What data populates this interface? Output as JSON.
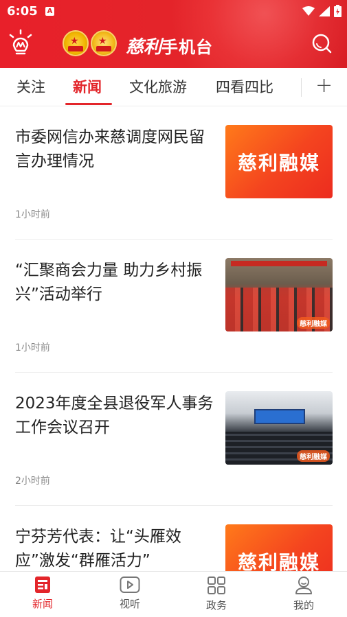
{
  "status_bar": {
    "time": "6:05",
    "notification_icon": "A"
  },
  "header": {
    "brand_script": "慈利",
    "brand_suffix": "手机台"
  },
  "tabs": [
    {
      "label": "关注"
    },
    {
      "label": "新闻"
    },
    {
      "label": "文化旅游"
    },
    {
      "label": "四看四比"
    }
  ],
  "news": [
    {
      "title": "市委网信办来慈调度网民留言办理情况",
      "time": "1小时前",
      "thumb_text": "慈利融媒"
    },
    {
      "title": "“汇聚商会力量 助力乡村振兴”活动举行",
      "time": "1小时前",
      "thumb_tag": "慈利融媒"
    },
    {
      "title": "2023年度全县退役军人事务工作会议召开",
      "time": "2小时前",
      "thumb_tag": "慈利融媒"
    },
    {
      "title": "宁芬芳代表：让“头雁效应”激发“群雁活力”",
      "thumb_text": "慈利融媒"
    }
  ],
  "bottom_nav": [
    {
      "label": "新闻"
    },
    {
      "label": "视听"
    },
    {
      "label": "政务"
    },
    {
      "label": "我的"
    }
  ],
  "colors": {
    "accent": "#e3252a"
  }
}
